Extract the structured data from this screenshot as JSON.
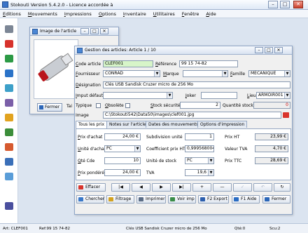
{
  "app": {
    "title": "Stokouti Version 5.4.2.0 - Licence accordée à"
  },
  "menu": [
    "Editions",
    "Mouvements",
    "Impressions",
    "Options",
    "Inventaire",
    "Utilitaires",
    "Fenêtre",
    "Aide"
  ],
  "image_window": {
    "title": "Image de l'article",
    "close_label": "Fermer",
    "side_text": "Tai"
  },
  "form": {
    "title": "Gestion des articles: Article 1 / 10",
    "labels": {
      "code": "Code article",
      "reference": "Référence",
      "fournisseur": "Fournisseur",
      "marque": "Marque",
      "famille": "Famille",
      "designation": "Désignation",
      "imputation": "Imput défaut",
      "joker": "Joker",
      "lieu": "Lieu",
      "typique": "Typique",
      "obsolete": "Obsolète",
      "stock_securite": "Stock sécurité",
      "quantite_stock": "Quantité stock",
      "image": "Image"
    },
    "values": {
      "code": "CLEF001",
      "reference": "99 15 74-82",
      "fournisseur": "CONRAD",
      "marque": "",
      "famille": "MECANIQUE",
      "designation": "Clés USB Sandisk Cruzer micro de 256 Mo",
      "imputation": "",
      "joker": "",
      "lieu": "ARMOIR001",
      "stock_securite": "2",
      "quantite_stock": "0",
      "image": "C:\\Stokouti542\\Data50\\images\\clef001.jpg"
    },
    "tabs": [
      "Tous les prix",
      "Notes sur l'article",
      "Dates des mouvements",
      "Options d'impression"
    ],
    "prices": {
      "prix_achat_label": "Prix d'achat",
      "prix_achat": "24,00 €",
      "subdivision_label": "Subdivision unité",
      "subdivision": "1",
      "prix_ht_label": "Prix HT",
      "prix_ht": "23,99 €",
      "unite_achat_label": "Unité d'achat",
      "unite_achat": "PC",
      "coef_label": "Coefficient prix HT",
      "coef": "0,9995680045",
      "valeur_tva_label": "Valeur TVA",
      "valeur_tva": "4,70 €",
      "qte_cde_label": "Qté Cde",
      "qte_cde": "10",
      "unite_stock_label": "Unité de stock",
      "unite_stock": "PC",
      "prix_ttc_label": "Prix TTC",
      "prix_ttc": "28,69 €",
      "prix_pondere_label": "Prix pondéré",
      "prix_pondere": "24,00 €",
      "tva_label": "TVA",
      "tva": "19,6"
    },
    "nav": {
      "delete": "Effacer",
      "first": "|◀",
      "prev": "◀",
      "next": "▶",
      "last": "▶|",
      "add": "+",
      "remove": "—",
      "ok": "✓",
      "undo": "↶",
      "refresh": "↻"
    },
    "actions": [
      "Chercher",
      "Filtrage",
      "Imprimer",
      "Voir imp",
      "F2 Export",
      "F1 Aide",
      "Fermer"
    ]
  },
  "status": {
    "art": "Art: CLEF001",
    "ref": "Ref:99 15 74-82",
    "designation": "Clés USB Sandisk Cruzer micro de 256 Mo",
    "qte": "Qté:0",
    "scu": "Scu:2"
  }
}
